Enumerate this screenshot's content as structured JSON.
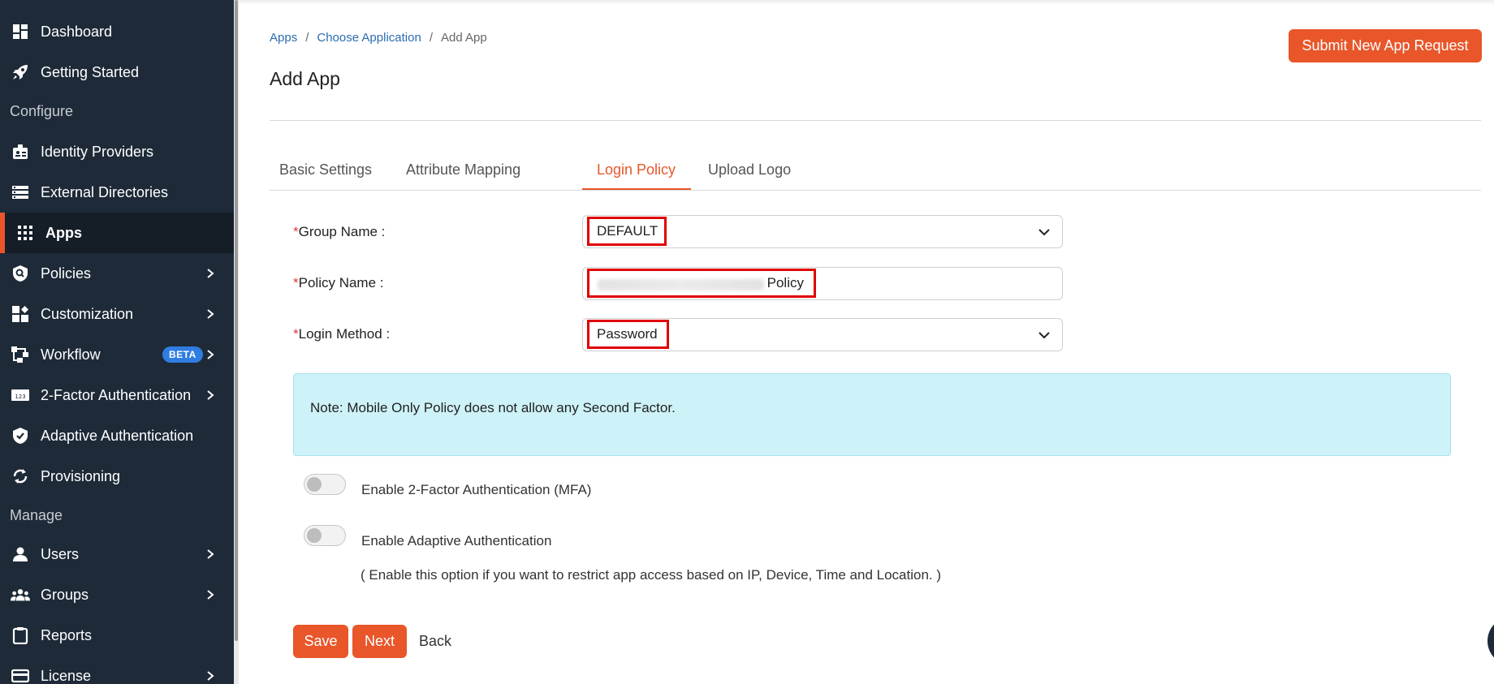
{
  "sidebar": {
    "items": [
      {
        "label": "Dashboard",
        "icon": "dashboard-icon"
      },
      {
        "label": "Getting Started",
        "icon": "rocket-icon"
      },
      {
        "label": "Identity Providers",
        "icon": "id-badge-icon"
      },
      {
        "label": "External Directories",
        "icon": "directory-list-icon"
      },
      {
        "label": "Apps",
        "icon": "apps-grid-icon",
        "active": true
      },
      {
        "label": "Policies",
        "icon": "policy-shield-icon",
        "expandable": true
      },
      {
        "label": "Customization",
        "icon": "customization-icon",
        "expandable": true
      },
      {
        "label": "Workflow",
        "icon": "workflow-icon",
        "expandable": true,
        "badge": "BETA"
      },
      {
        "label": "2-Factor Authentication",
        "icon": "two-factor-icon",
        "expandable": true
      },
      {
        "label": "Adaptive Authentication",
        "icon": "shield-check-icon"
      },
      {
        "label": "Provisioning",
        "icon": "sync-icon"
      },
      {
        "label": "Users",
        "icon": "user-icon",
        "expandable": true
      },
      {
        "label": "Groups",
        "icon": "groups-icon",
        "expandable": true
      },
      {
        "label": "Reports",
        "icon": "clipboard-icon"
      },
      {
        "label": "License",
        "icon": "license-card-icon",
        "expandable": true
      }
    ],
    "sections": {
      "configure": "Configure",
      "manage": "Manage"
    }
  },
  "breadcrumb": {
    "apps": "Apps",
    "choose": "Choose Application",
    "current": "Add App",
    "separator": "/"
  },
  "page_title": "Add App",
  "submit_button": "Submit New App Request",
  "tabs": [
    {
      "label": "Basic Settings"
    },
    {
      "label": "Attribute Mapping"
    },
    {
      "label": "Login Policy",
      "active": true
    },
    {
      "label": "Upload Logo"
    }
  ],
  "form": {
    "required_mark": "*",
    "group_name": {
      "label": "Group Name :",
      "value": "DEFAULT"
    },
    "policy_name": {
      "label": "Policy Name :",
      "value": "Policy"
    },
    "login_method": {
      "label": "Login Method :",
      "value": "Password"
    }
  },
  "note": "Note: Mobile Only Policy does not allow any Second Factor.",
  "toggles": {
    "mfa": {
      "label": "Enable 2-Factor Authentication (MFA)",
      "enabled": false
    },
    "adaptive": {
      "label": "Enable Adaptive Authentication",
      "enabled": false
    }
  },
  "adaptive_hint": "( Enable this option if you want to restrict app access based on IP, Device, Time and Location. )",
  "actions": {
    "save": "Save",
    "next": "Next",
    "back": "Back"
  },
  "colors": {
    "accent": "#e8562a",
    "sidebar_bg": "#1e2a38",
    "note_bg": "#cdf2f8",
    "link": "#2b6cb0",
    "highlight": "#e00000",
    "beta": "#2f7de1"
  }
}
